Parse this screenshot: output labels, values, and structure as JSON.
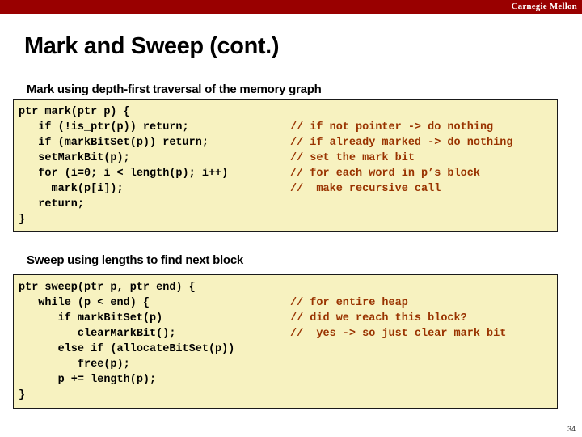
{
  "banner": {
    "brand": "Carnegie Mellon",
    "color": "#990000"
  },
  "slide": {
    "title": "Mark and Sweep (cont.)",
    "page_number": "34"
  },
  "sections": [
    {
      "heading": "Mark using depth-first traversal of the memory graph",
      "code_background": "#f7f2c0",
      "comment_color": "#993300",
      "lines": [
        {
          "code": "ptr mark(ptr p) {",
          "comment": ""
        },
        {
          "code": "   if (!is_ptr(p)) return;",
          "comment": "// if not pointer -> do nothing"
        },
        {
          "code": "   if (markBitSet(p)) return;",
          "comment": "// if already marked -> do nothing"
        },
        {
          "code": "   setMarkBit(p);",
          "comment": "// set the mark bit"
        },
        {
          "code": "   for (i=0; i < length(p); i++)",
          "comment": "// for each word in p’s block"
        },
        {
          "code": "     mark(p[i]);",
          "comment": "//  make recursive call"
        },
        {
          "code": "   return;",
          "comment": ""
        },
        {
          "code": "}",
          "comment": ""
        }
      ]
    },
    {
      "heading": "Sweep using lengths to find next block",
      "code_background": "#f7f2c0",
      "comment_color": "#993300",
      "lines": [
        {
          "code": "ptr sweep(ptr p, ptr end) {",
          "comment": ""
        },
        {
          "code": "   while (p < end) {",
          "comment": "// for entire heap"
        },
        {
          "code": "      if markBitSet(p)",
          "comment": "// did we reach this block?"
        },
        {
          "code": "         clearMarkBit();",
          "comment": "//  yes -> so just clear mark bit"
        },
        {
          "code": "      else if (allocateBitSet(p))",
          "comment": ""
        },
        {
          "code": "         free(p);",
          "comment": ""
        },
        {
          "code": "      p += length(p);",
          "comment": ""
        },
        {
          "code": "}",
          "comment": ""
        }
      ]
    }
  ]
}
